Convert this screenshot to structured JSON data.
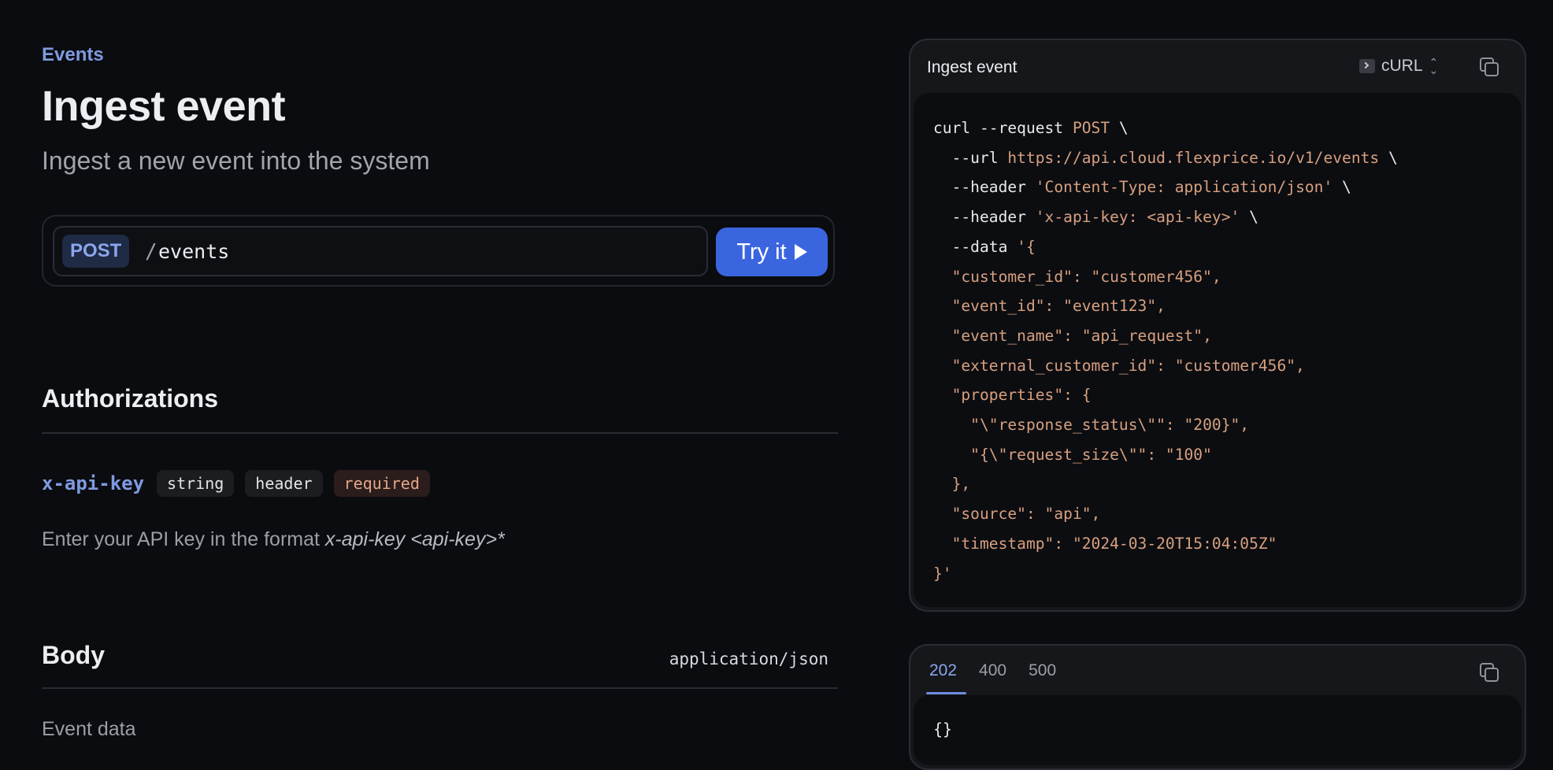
{
  "breadcrumb": "Events",
  "title": "Ingest event",
  "subtitle": "Ingest a new event into the system",
  "endpoint": {
    "method": "POST",
    "slash": "/",
    "path": "events",
    "try_label": "Try it"
  },
  "authorizations": {
    "heading": "Authorizations",
    "param": {
      "name": "x-api-key",
      "chips": [
        "string",
        "header",
        "required"
      ]
    },
    "description_prefix": "Enter your API key in the format ",
    "description_italic": "x-api-key <api-key>*"
  },
  "body": {
    "heading": "Body",
    "content_type": "application/json",
    "description": "Event data"
  },
  "request_panel": {
    "title": "Ingest event",
    "language": "cURL",
    "code_lines": [
      [
        {
          "t": "curl --request ",
          "c": "kw"
        },
        {
          "t": "POST",
          "c": "str"
        },
        {
          "t": " \\",
          "c": "kw"
        }
      ],
      [
        {
          "t": "  --url ",
          "c": "kw"
        },
        {
          "t": "https://api.cloud.flexprice.io/v1/events",
          "c": "str"
        },
        {
          "t": " \\",
          "c": "kw"
        }
      ],
      [
        {
          "t": "  --header ",
          "c": "kw"
        },
        {
          "t": "'Content-Type: application/json'",
          "c": "str"
        },
        {
          "t": " \\",
          "c": "kw"
        }
      ],
      [
        {
          "t": "  --header ",
          "c": "kw"
        },
        {
          "t": "'x-api-key: <api-key>'",
          "c": "str"
        },
        {
          "t": " \\",
          "c": "kw"
        }
      ],
      [
        {
          "t": "  --data ",
          "c": "kw"
        },
        {
          "t": "'{",
          "c": "str"
        }
      ],
      [
        {
          "t": "  \"customer_id\": \"customer456\",",
          "c": "str"
        }
      ],
      [
        {
          "t": "  \"event_id\": \"event123\",",
          "c": "str"
        }
      ],
      [
        {
          "t": "  \"event_name\": \"api_request\",",
          "c": "str"
        }
      ],
      [
        {
          "t": "  \"external_customer_id\": \"customer456\",",
          "c": "str"
        }
      ],
      [
        {
          "t": "  \"properties\": {",
          "c": "str"
        }
      ],
      [
        {
          "t": "    \"\\\"response_status\\\"\": \"200}\",",
          "c": "str"
        }
      ],
      [
        {
          "t": "    \"{\\\"request_size\\\"\": \"100\"",
          "c": "str"
        }
      ],
      [
        {
          "t": "  },",
          "c": "str"
        }
      ],
      [
        {
          "t": "  \"source\": \"api\",",
          "c": "str"
        }
      ],
      [
        {
          "t": "  \"timestamp\": \"2024-03-20T15:04:05Z\"",
          "c": "str"
        }
      ],
      [
        {
          "t": "}'",
          "c": "str"
        }
      ]
    ]
  },
  "response_panel": {
    "tabs": [
      "202",
      "400",
      "500"
    ],
    "active_tab": "202",
    "code": "{}"
  }
}
